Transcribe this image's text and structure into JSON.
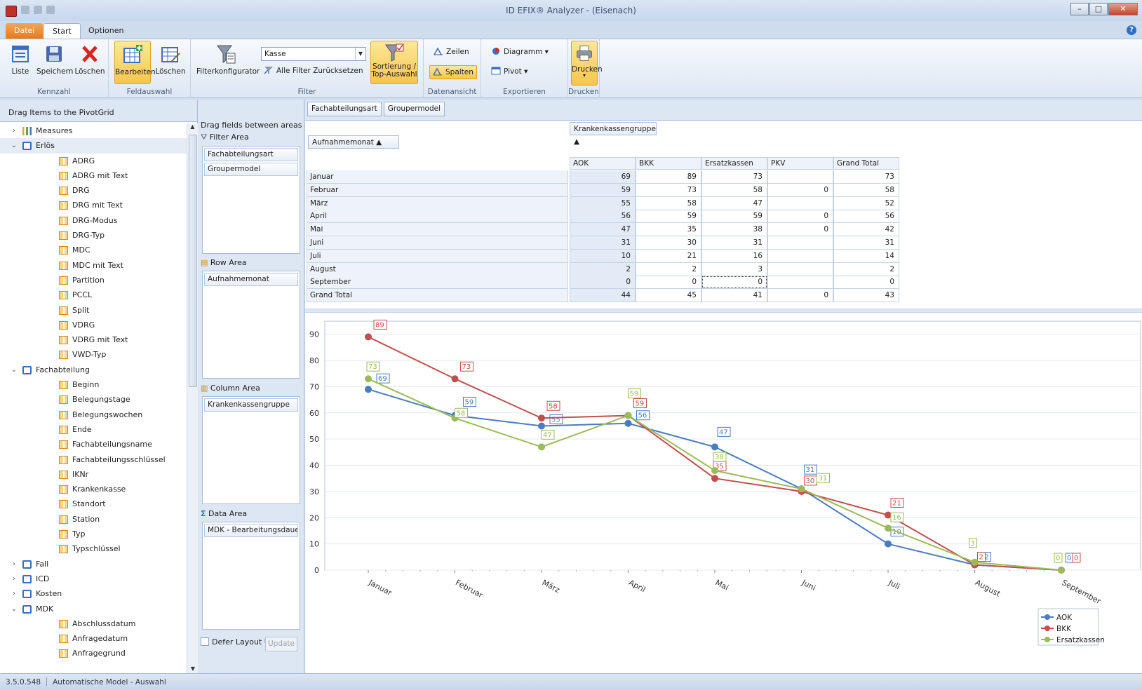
{
  "window": {
    "title": "ID EFIX® Analyzer - (Eisenach)"
  },
  "tabs": {
    "file": "Datei",
    "start": "Start",
    "options": "Optionen"
  },
  "ribbon": {
    "kennzahl": {
      "label": "Kennzahl",
      "liste": "Liste",
      "speichern": "Speichern",
      "loeschen": "Löschen"
    },
    "feldauswahl": {
      "label": "Feldauswahl",
      "bearbeiten": "Bearbeiten",
      "loeschen": "Löschen"
    },
    "filter": {
      "label": "Filter",
      "konfigurator": "Filterkonfigurator",
      "combo_value": "Kasse",
      "reset": "Alle Filter Zurücksetzen",
      "sort": "Sortierung /",
      "sort2": "Top-Auswahl"
    },
    "datenansicht": {
      "label": "Datenansicht",
      "zeilen": "Zeilen",
      "spalten": "Spalten"
    },
    "exportieren": {
      "label": "Exportieren",
      "diagramm": "Diagramm",
      "pivot": "Pivot"
    },
    "drucken": {
      "label": "Drucken",
      "drucken": "Drucken"
    }
  },
  "left": {
    "header": "Drag Items to the PivotGrid",
    "tree": [
      {
        "label": "Measures",
        "type": "meas",
        "level": 0,
        "exp": ">"
      },
      {
        "label": "Erlös",
        "type": "dim",
        "level": 0,
        "exp": "v",
        "sel": true
      },
      {
        "label": "ADRG",
        "type": "fld",
        "level": 1
      },
      {
        "label": "ADRG mit Text",
        "type": "fld",
        "level": 1
      },
      {
        "label": "DRG",
        "type": "fld",
        "level": 1
      },
      {
        "label": "DRG mit Text",
        "type": "fld",
        "level": 1
      },
      {
        "label": "DRG-Modus",
        "type": "fld",
        "level": 1
      },
      {
        "label": "DRG-Typ",
        "type": "fld",
        "level": 1
      },
      {
        "label": "MDC",
        "type": "fld",
        "level": 1
      },
      {
        "label": "MDC mit Text",
        "type": "fld",
        "level": 1
      },
      {
        "label": "Partition",
        "type": "fld",
        "level": 1
      },
      {
        "label": "PCCL",
        "type": "fld",
        "level": 1
      },
      {
        "label": "Split",
        "type": "fld",
        "level": 1
      },
      {
        "label": "VDRG",
        "type": "fld",
        "level": 1
      },
      {
        "label": "VDRG mit Text",
        "type": "fld",
        "level": 1
      },
      {
        "label": "VWD-Typ",
        "type": "fld",
        "level": 1
      },
      {
        "label": "Fachabteilung",
        "type": "dim",
        "level": 0,
        "exp": "v"
      },
      {
        "label": "Beginn",
        "type": "fld",
        "level": 1
      },
      {
        "label": "Belegungstage",
        "type": "fld",
        "level": 1
      },
      {
        "label": "Belegungswochen",
        "type": "fld",
        "level": 1
      },
      {
        "label": "Ende",
        "type": "fld",
        "level": 1
      },
      {
        "label": "Fachabteilungsname",
        "type": "fld",
        "level": 1
      },
      {
        "label": "Fachabteilungsschlüssel",
        "type": "fld",
        "level": 1
      },
      {
        "label": "IKNr",
        "type": "fld",
        "level": 1
      },
      {
        "label": "Krankenkasse",
        "type": "fld",
        "level": 1
      },
      {
        "label": "Standort",
        "type": "fld",
        "level": 1
      },
      {
        "label": "Station",
        "type": "fld",
        "level": 1
      },
      {
        "label": "Typ",
        "type": "fld",
        "level": 1
      },
      {
        "label": "Typschlüssel",
        "type": "fld",
        "level": 1
      },
      {
        "label": "Fall",
        "type": "dim",
        "level": 0,
        "exp": ">"
      },
      {
        "label": "ICD",
        "type": "dim",
        "level": 0,
        "exp": ">"
      },
      {
        "label": "Kosten",
        "type": "dim",
        "level": 0,
        "exp": ">"
      },
      {
        "label": "MDK",
        "type": "dim",
        "level": 0,
        "exp": "v"
      },
      {
        "label": "Abschlussdatum",
        "type": "fld",
        "level": 1
      },
      {
        "label": "Anfragedatum",
        "type": "fld",
        "level": 1
      },
      {
        "label": "Anfragegrund",
        "type": "fld",
        "level": 1
      }
    ]
  },
  "areas": {
    "hint": "Drag fields between areas ...",
    "filter": {
      "label": "Filter Area",
      "items": [
        "Fachabteilungsart",
        "Groupermodel"
      ]
    },
    "row": {
      "label": "Row Area",
      "items": [
        "Aufnahmemonat"
      ]
    },
    "column": {
      "label": "Column Area",
      "items": [
        "Krankenkassengruppe"
      ]
    },
    "data": {
      "label": "Data Area",
      "items": [
        "MDK - Bearbeitungsdauer pr"
      ]
    },
    "defer": "Defer Layout Up",
    "update": "Update"
  },
  "pivot": {
    "filter_chips": [
      "Fachabteilungsart",
      "Groupermodel"
    ],
    "column_field": "Krankenkassengruppe ▲",
    "row_field": "Aufnahmemonat ▲",
    "columns": [
      "AOK",
      "BKK",
      "Ersatzkassen",
      "PKV",
      "Grand Total"
    ],
    "rows": [
      {
        "label": "Januar",
        "values": [
          "69",
          "89",
          "73",
          "",
          "73"
        ]
      },
      {
        "label": "Februar",
        "values": [
          "59",
          "73",
          "58",
          "0",
          "58"
        ]
      },
      {
        "label": "März",
        "values": [
          "55",
          "58",
          "47",
          "",
          "52"
        ]
      },
      {
        "label": "April",
        "values": [
          "56",
          "59",
          "59",
          "0",
          "56"
        ]
      },
      {
        "label": "Mai",
        "values": [
          "47",
          "35",
          "38",
          "0",
          "42"
        ]
      },
      {
        "label": "Juni",
        "values": [
          "31",
          "30",
          "31",
          "",
          "31"
        ]
      },
      {
        "label": "Juli",
        "values": [
          "10",
          "21",
          "16",
          "",
          "14"
        ]
      },
      {
        "label": "August",
        "values": [
          "2",
          "2",
          "3",
          "",
          "2"
        ]
      },
      {
        "label": "September",
        "values": [
          "0",
          "0",
          "0",
          "",
          "0"
        ]
      },
      {
        "label": "Grand Total",
        "values": [
          "44",
          "45",
          "41",
          "0",
          "43"
        ]
      }
    ]
  },
  "chart_data": {
    "type": "line",
    "categories": [
      "Januar",
      "Februar",
      "März",
      "April",
      "Mai",
      "Juni",
      "Juli",
      "August",
      "September"
    ],
    "ylim": [
      0,
      95
    ],
    "yticks": [
      0,
      10,
      20,
      30,
      40,
      50,
      60,
      70,
      80,
      90
    ],
    "series": [
      {
        "name": "AOK",
        "color": "#4a7cc0",
        "values": [
          69,
          59,
          55,
          56,
          47,
          31,
          10,
          2,
          0
        ]
      },
      {
        "name": "BKK",
        "color": "#c0504d",
        "values": [
          89,
          73,
          58,
          59,
          35,
          30,
          21,
          2,
          0
        ]
      },
      {
        "name": "Ersatzkassen",
        "color": "#9bbb59",
        "values": [
          73,
          58,
          47,
          59,
          38,
          31,
          16,
          3,
          0
        ]
      }
    ],
    "legend": "bottom-right"
  },
  "status": {
    "version": "3.5.0.548",
    "text": "Automatische Model - Auswahl"
  }
}
